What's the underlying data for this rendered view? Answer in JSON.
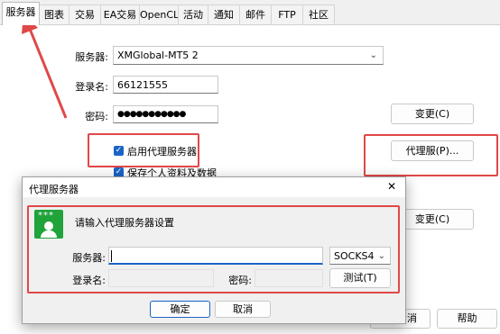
{
  "tabs": [
    {
      "label": "服务器",
      "active": true
    },
    {
      "label": "图表"
    },
    {
      "label": "交易"
    },
    {
      "label": "EA交易"
    },
    {
      "label": "OpenCL"
    },
    {
      "label": "活动"
    },
    {
      "label": "通知"
    },
    {
      "label": "邮件"
    },
    {
      "label": "FTP"
    },
    {
      "label": "社区"
    }
  ],
  "server_tab": {
    "server_label": "服务器:",
    "server_value": "XMGlobal-MT5 2",
    "login_label": "登录名:",
    "login_value": "66121555",
    "password_label": "密码:",
    "password_value": "●●●●●●●●●●●",
    "change_button": "变更(C)",
    "use_proxy_label": "启用代理服务器",
    "use_proxy_checked": true,
    "proxy_button": "代理服(P)...",
    "save_info_label": "保存个人资料及数据",
    "save_info_checked": true,
    "change_button_2": "变更(C)"
  },
  "footer": {
    "cancel_label": "消",
    "help_label": "帮助"
  },
  "dialog": {
    "title": "代理服务器",
    "close_glyph": "✕",
    "prompt": "请输入代理服务器设置",
    "server_label": "服务器:",
    "server_value": "",
    "protocol_value": "SOCKS4",
    "login_label": "登录名:",
    "password_label": "密码:",
    "test_button": "测试(T)",
    "ok_button": "确定",
    "cancel_button": "取消",
    "icon_stars": "***"
  },
  "colors": {
    "annotation_red": "#e04848",
    "icon_green": "#1fa33a",
    "checkbox_blue": "#1a64c8"
  }
}
